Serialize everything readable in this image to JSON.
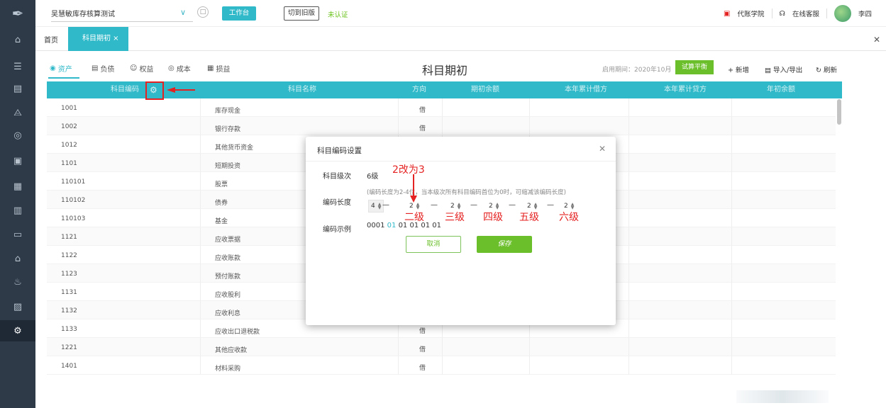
{
  "header": {
    "company": "吴慧敏库存核算测试",
    "workspace_button": "工作台",
    "old_version_button": "切到旧版",
    "unverified": "未认证",
    "academy": "代账学院",
    "service": "在线客服",
    "user": "李四"
  },
  "tabs": {
    "home": "首页",
    "active": "科目期初 ×"
  },
  "categories": [
    "资产",
    "负债",
    "权益",
    "成本",
    "损益"
  ],
  "toolbar": {
    "title": "科目期初",
    "enable_period": "启用期间：2020年10月",
    "trial_balance": "试算平衡",
    "add": "+ 新增",
    "import_export": "导入/导出",
    "refresh": "刷新"
  },
  "table": {
    "headers": [
      "科目编码",
      "科目名称",
      "方向",
      "期初余额",
      "本年累计借方",
      "本年累计贷方",
      "年初余额"
    ],
    "rows": [
      {
        "code": "1001",
        "name": "库存现金",
        "dir": "借"
      },
      {
        "code": "1002",
        "name": "银行存款",
        "dir": "借"
      },
      {
        "code": "1012",
        "name": "其他货币资金",
        "dir": ""
      },
      {
        "code": "1101",
        "name": "短期投资",
        "dir": ""
      },
      {
        "code": "110101",
        "name": "股票",
        "dir": ""
      },
      {
        "code": "110102",
        "name": "债券",
        "dir": ""
      },
      {
        "code": "110103",
        "name": "基金",
        "dir": ""
      },
      {
        "code": "1121",
        "name": "应收票据",
        "dir": ""
      },
      {
        "code": "1122",
        "name": "应收账款",
        "dir": ""
      },
      {
        "code": "1123",
        "name": "预付账款",
        "dir": ""
      },
      {
        "code": "1131",
        "name": "应收股利",
        "dir": ""
      },
      {
        "code": "1132",
        "name": "应收利息",
        "dir": ""
      },
      {
        "code": "1133",
        "name": "应收出口退税款",
        "dir": "借"
      },
      {
        "code": "1221",
        "name": "其他应收款",
        "dir": "借"
      },
      {
        "code": "1401",
        "name": "材料采购",
        "dir": "借"
      }
    ]
  },
  "modal": {
    "title": "科目编码设置",
    "level_label": "科目级次",
    "level_value": "6级",
    "length_label": "编码长度",
    "hint": "(编码长度为2-4位，当本级次所有科目编码首位为0时，可缩减该编码长度)",
    "lengths": [
      "4",
      "2",
      "2",
      "2",
      "2",
      "2"
    ],
    "example_label": "编码示例",
    "example_prefix": "0001",
    "example_highlight": "01",
    "example_rest": "01 01 01 01",
    "cancel": "取消",
    "save": "保存"
  },
  "annotations": {
    "change_note": "2改为3",
    "levels": [
      "二级",
      "三级",
      "四级",
      "五级",
      "六级"
    ]
  },
  "colors": {
    "accent": "#30b9c9",
    "green": "#6bbf2b",
    "annotation_red": "#e52222",
    "sidebar": "#2e3a48"
  }
}
